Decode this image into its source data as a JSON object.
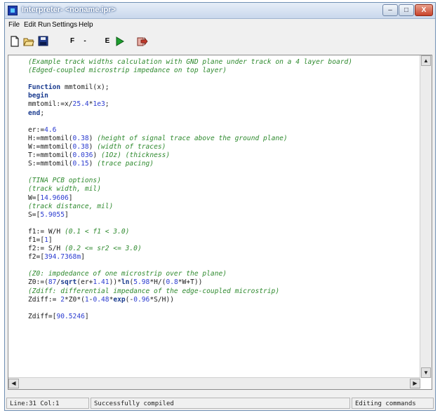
{
  "window": {
    "title": "Interpreter- <noname.ipr>",
    "controls": [
      "–",
      "□",
      "X"
    ]
  },
  "menu": [
    "File",
    "Edit",
    "Run",
    "Settings",
    "Help"
  ],
  "toolbar": {
    "letters": [
      "F",
      "-",
      "E"
    ],
    "colors": {
      "save": "#1e3a8a",
      "run": "#1e9e2e",
      "exit": "#c0392b"
    }
  },
  "code_lines": [
    "(Example track widths calculation with GND plane under track on a 4 layer board)",
    "(Edged-coupled microstrip impedance on top layer)",
    "",
    "Function mmtomil(x);",
    "begin",
    "mmtomil:=x/25.4*1e3;",
    "end;",
    "",
    "er:=4.6",
    "H:=mmtomil(0.38) (height of signal trace above the ground plane)",
    "W:=mmtomil(0.38) (width of traces)",
    "T:=mmtomil(0.036) (1Oz) (thickness)",
    "S:=mmtomil(0.15) (trace pacing)",
    "",
    "(TINA PCB options)",
    "(track width, mil)",
    "W=[14.9606]",
    "(track distance, mil)",
    "S=[5.9055]",
    "",
    "f1:= W/H (0.1 < f1 < 3.0)",
    "f1=[1]",
    "f2:= S/H (0.2 <= sr2 <= 3.0)",
    "f2=[394.7368m]",
    "",
    "(Z0: impdedance of one microstrip over the plane)",
    "Z0:=(87/sqrt(er+1.41))*ln(5.98*H/(0.8*W+T))",
    "(Zdiff: differential impedance of the edge-coupled microstrip)",
    "Zdiff:= 2*Z0*(1-0.48*exp(-0.96*S/H))",
    "",
    "Zdiff=[90.5246]"
  ],
  "status": {
    "position": "Line:31 Col:1",
    "message": "Successfully compiled",
    "mode": "Editing commands"
  }
}
